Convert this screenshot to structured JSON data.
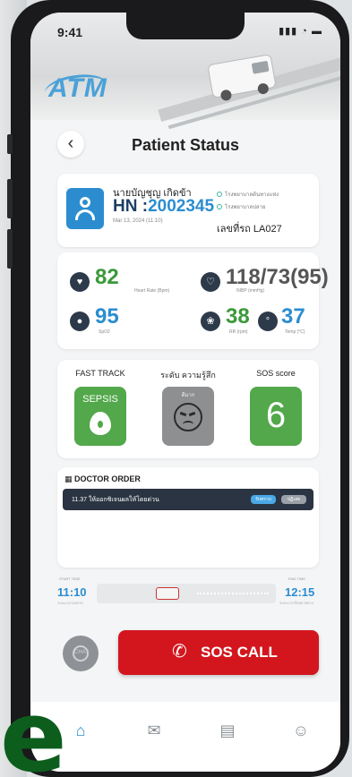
{
  "status_bar": {
    "time": "9:41",
    "icons": "▮▮▮ ◔ ▬"
  },
  "app": {
    "logo_text": "ATM",
    "title": "Patient Status"
  },
  "patient": {
    "name": "นายบัญชุญ เกิดข้า",
    "hn_label": "HN :",
    "hn_value": "2002345",
    "date": "Mar 13, 2024 (11:10)",
    "legend_1": "โรงพยาบาลต้นทางแห่ง",
    "legend_2": "โรงพยาบาลปลาย",
    "car_label": "เลขที่รถ LA027"
  },
  "vitals": [
    {
      "icon": "heart-icon",
      "glyph": "♥",
      "value": "82",
      "unit": "Heart Rate (Bpm)",
      "color": "#3a9a3a"
    },
    {
      "icon": "blood-pressure-icon",
      "glyph": "♡",
      "value": "118/73(95)",
      "unit": "NIBP (mmHg)",
      "color": "#555555"
    },
    {
      "icon": "oxygen-icon",
      "glyph": "●",
      "value": "95",
      "unit": "SpO2",
      "color": "#2b8dd0"
    },
    {
      "icon": "lungs-icon",
      "glyph": "❀",
      "value": "38",
      "unit": "RR (rpm)",
      "color": "#3a9a3a"
    },
    {
      "icon": "thermometer-icon",
      "glyph": "°",
      "value": "37",
      "unit": "Temp (°C)",
      "color": "#2b8dd0"
    }
  ],
  "track": {
    "fast_track_label": "FAST TRACK",
    "sepsis_label": "SEPSIS",
    "feeling_label": "ระดับ ความรู้สึก",
    "feeling_value": "ดีมาก",
    "sos_label": "SOS score",
    "sos_value": "6"
  },
  "order": {
    "title": "DOCTOR ORDER",
    "text": "11.37 ให้ออกซิเจนผลให้โดยด่วน",
    "btn_1": "รับทราบ",
    "btn_2": "ปฏิเสธ"
  },
  "timeline": {
    "start_label": "START TIME",
    "start_time": "11:10",
    "start_sub": "ระยะเวลาออกรถ",
    "end_label": "END TIME",
    "end_time": "12:15",
    "end_sub": "ระยะเวลาถึงปลายทาง"
  },
  "actions": {
    "chat_label": "CHAT",
    "sos_call": "SOS CALL"
  },
  "overlay_letter": "e",
  "colors": {
    "primary": "#2b8dd0",
    "danger": "#d3161e",
    "success": "#52a84a"
  }
}
